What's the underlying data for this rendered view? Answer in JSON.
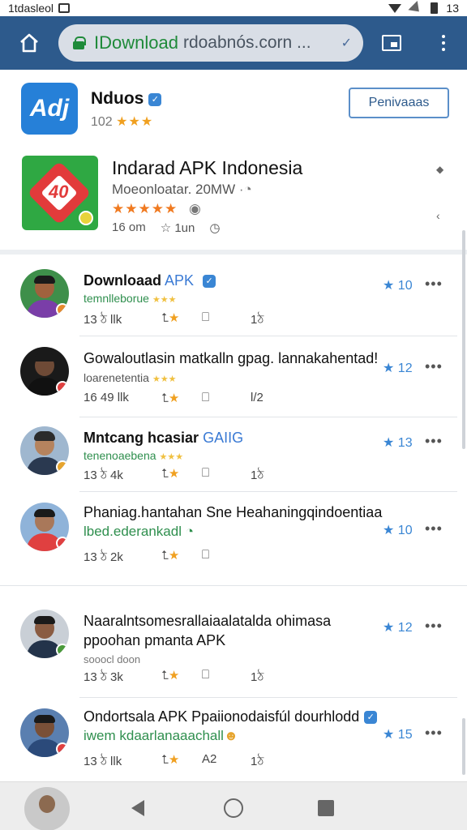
{
  "status_bar": {
    "left_text": "1tdasleol",
    "right_text": "13"
  },
  "browser": {
    "url_domain": "IDownload",
    "url_path": "rdoabnós.corn ...",
    "check_glyph": "✓"
  },
  "app": {
    "name": "Nduos",
    "rating": "102",
    "rating_stars": "★★★",
    "action_label": "Penivaaas",
    "logo_text": "Adj"
  },
  "featured": {
    "title": "Indarad APK Indonesia",
    "subtitle": "Moeonloatar. 20MW",
    "stars": "★★★★★",
    "stat_1": "16 om",
    "stat_2": "1un",
    "icon_text": "40"
  },
  "posts": [
    {
      "title": "Downloaad",
      "title_accent": "APK",
      "line2": "",
      "sub": "temnlleborue",
      "sub_stars": "★★★",
      "meta_1": "13 ঠ  llk",
      "meta_2": "",
      "meta_3": "",
      "meta_4": "1ঠ",
      "count": "10",
      "badge_color": "#e68a2e",
      "face": "#a0623e",
      "shirt": "#7a3ea8"
    },
    {
      "title": "Gowaloutlasin matkalln gpag. lannakahentad!",
      "title_accent": "",
      "line2": "",
      "sub": "loarenetentia",
      "sub_stars": "★★★",
      "meta_1": "16 49  llk",
      "meta_2": "",
      "meta_3": "",
      "meta_4": "l/2",
      "count": "12",
      "badge_color": "#e04040",
      "face": "#6e4a36",
      "shirt": "#1c1c1c"
    },
    {
      "title": "Mntcang hcasiar",
      "title_accent": "GAIIG",
      "line2": "",
      "sub": "tenenoaebena",
      "sub_stars": "★★★",
      "meta_1": "13 ঠ  4k",
      "meta_2": "",
      "meta_3": "",
      "meta_4": "1ঠ",
      "count": "13",
      "badge_color": "#e6a42e",
      "face": "#b5835e",
      "shirt": "#2a3950"
    },
    {
      "title": "Phaniag.hantahan Sne Heahaningqindoentiaa",
      "title_accent": "",
      "line2": "",
      "sub": "lbed.ederankadl",
      "sub_stars": "",
      "meta_1": "13 ঠ  2k",
      "meta_2": "",
      "meta_3": "",
      "meta_4": "",
      "count": "10",
      "badge_color": "#e04040",
      "face": "#a9785a",
      "shirt": "#e04040"
    },
    {
      "title": "Naaralntsomesrallaiaalatalda ohimasa",
      "title_accent": "",
      "line2": "ppoohan pmanta APK",
      "sub": "sooocl doon",
      "sub_stars": "",
      "meta_1": "13 ঠ  3k",
      "meta_2": "",
      "meta_3": "",
      "meta_4": "1ঠ",
      "count": "12",
      "badge_color": "#4a9a3a",
      "face": "#8a5c42",
      "shirt": "#23334a"
    },
    {
      "title": "Ondortsala APK Ppaiionodaisfúl dourhlodd",
      "title_accent": "",
      "line2": "iwem kdaarlanaaachall",
      "sub": "",
      "sub_stars": "",
      "meta_1": "13 ঠ  llk",
      "meta_2": "",
      "meta_3": "A2",
      "meta_4": "1ঠ",
      "count": "15",
      "badge_color": "#e04040",
      "face": "#7a5038",
      "shirt": "#2b4a7a"
    }
  ]
}
